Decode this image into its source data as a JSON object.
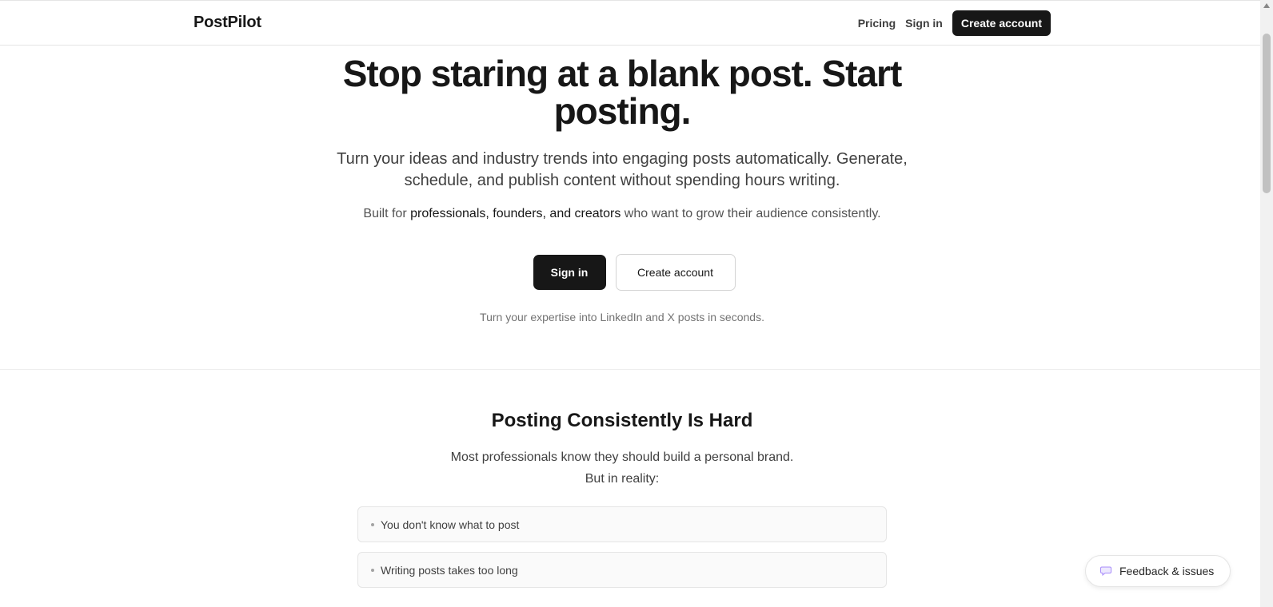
{
  "header": {
    "brand": "PostPilot",
    "nav": {
      "pricing": "Pricing",
      "sign_in": "Sign in",
      "create_account": "Create account"
    }
  },
  "hero": {
    "title": "Stop staring at a blank post. Start posting.",
    "subtitle": "Turn your ideas and industry trends into engaging posts automatically. Generate, schedule, and publish content without spending hours writing.",
    "built_prefix": "Built for ",
    "built_highlight": "professionals, founders, and creators",
    "built_suffix": " who want to grow their audience consistently.",
    "sign_in_button": "Sign in",
    "create_account_button": "Create account",
    "note": "Turn your expertise into LinkedIn and X posts in seconds."
  },
  "problem": {
    "title": "Posting Consistently Is Hard",
    "line1": "Most professionals know they should build a personal brand.",
    "line2": "But in reality:",
    "items": [
      "You don't know what to post",
      "Writing posts takes too long"
    ]
  },
  "feedback": {
    "label": "Feedback & issues",
    "icon": "speech-bubble-icon"
  },
  "colors": {
    "primary": "#171717",
    "border": "#e5e5e5",
    "muted_text": "#737373",
    "feedback_icon": "#a78bfa"
  }
}
